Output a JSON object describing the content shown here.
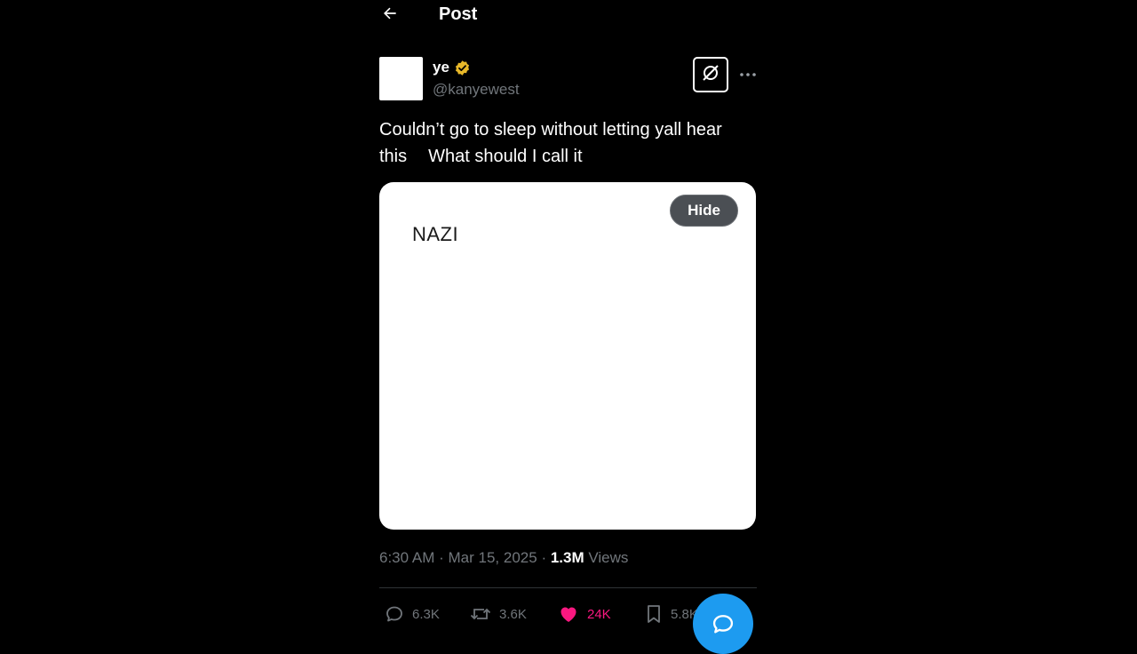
{
  "header": {
    "title": "Post"
  },
  "author": {
    "display_name": "ye",
    "handle": "@kanyewest"
  },
  "tweet": {
    "text_line1": "Couldn’t go to sleep without letting yall hear",
    "text_line2_a": "this",
    "text_line2_b": "What should I call it"
  },
  "media": {
    "card_text": "NAZI",
    "hide_label": "Hide"
  },
  "meta": {
    "time": "6:30 AM",
    "date": "Mar 15, 2025",
    "separator": "·",
    "views_count": "1.3M",
    "views_label": "Views"
  },
  "actions": {
    "replies": "6.3K",
    "reposts": "3.6K",
    "likes": "24K",
    "bookmarks": "5.8K"
  },
  "colors": {
    "background": "#000000",
    "accent": "#1d9bf0",
    "like": "#f91880",
    "verified": "#e8b829"
  }
}
